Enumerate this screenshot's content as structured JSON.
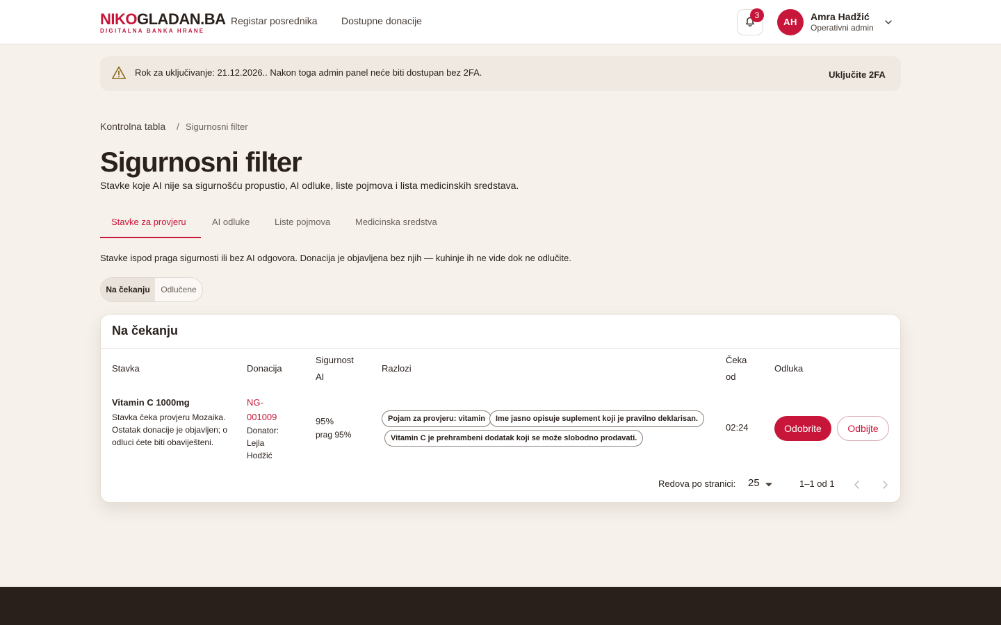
{
  "brand": {
    "logo_left": "NIKO",
    "logo_right": "GLADAN.BA",
    "tagline": "DIGITALNA BANKA HRANE",
    "accent_color": "#c8163a"
  },
  "nav": {
    "items": [
      "Registar posrednika",
      "Dostupne donacije"
    ]
  },
  "notifications": {
    "count": "3",
    "icon": "bell-icon"
  },
  "user": {
    "initials": "AH",
    "name": "Amra Hadžić",
    "role": "Operativni admin"
  },
  "alert": {
    "text": "Rok za uključivanje: 21.12.2026.. Nakon toga admin panel neće biti dostupan bez 2FA.",
    "action": "Uključite 2FA",
    "icon": "warning-icon"
  },
  "breadcrumb": {
    "home": "Kontrolna tabla",
    "separator": "/",
    "current": "Sigurnosni filter"
  },
  "page": {
    "title": "Sigurnosni filter",
    "subtitle": "Stavke koje AI nije sa sigurnošću propustio, AI odluke, liste pojmova i lista medicinskih sredstava."
  },
  "tabs": [
    {
      "label": "Stavke za provjeru",
      "active": true
    },
    {
      "label": "AI odluke",
      "active": false
    },
    {
      "label": "Liste pojmova",
      "active": false
    },
    {
      "label": "Medicinska sredstva",
      "active": false
    }
  ],
  "intro": "Stavke ispod praga sigurnosti ili bez AI odgovora. Donacija je objavljena bez njih — kuhinje ih ne vide dok ne odlučite.",
  "filter": {
    "options": [
      "Na čekanju",
      "Odlučene"
    ],
    "selected": "Na čekanju"
  },
  "table": {
    "title": "Na čekanju",
    "headers": {
      "item": "Stavka",
      "donation": "Donacija",
      "confidence": "Sigurnost AI",
      "reasons": "Razlozi",
      "waiting": "Čeka od",
      "decision": "Odluka"
    },
    "rows": [
      {
        "item_name": "Vitamin C 1000mg",
        "item_desc": "Stavka čeka provjeru Mozaika. Ostatak donacije je objavljen; o odluci ćete biti obaviješteni.",
        "donation_id": "NG-001009",
        "donor": "Donator: Lejla Hodžić",
        "confidence": "95%",
        "threshold": "prag 95%",
        "reasons": [
          "Pojam za provjeru: vitamin",
          "Ime jasno opisuje suplement koji je pravilno deklarisan.",
          "Vitamin C je prehrambeni dodatak koji se može slobodno prodavati."
        ],
        "waiting": "02:24",
        "approve_label": "Odobrite",
        "reject_label": "Odbijte"
      }
    ]
  },
  "pagination": {
    "rows_label": "Redova po stranici:",
    "rows_value": "25",
    "range": "1–1 od 1"
  }
}
